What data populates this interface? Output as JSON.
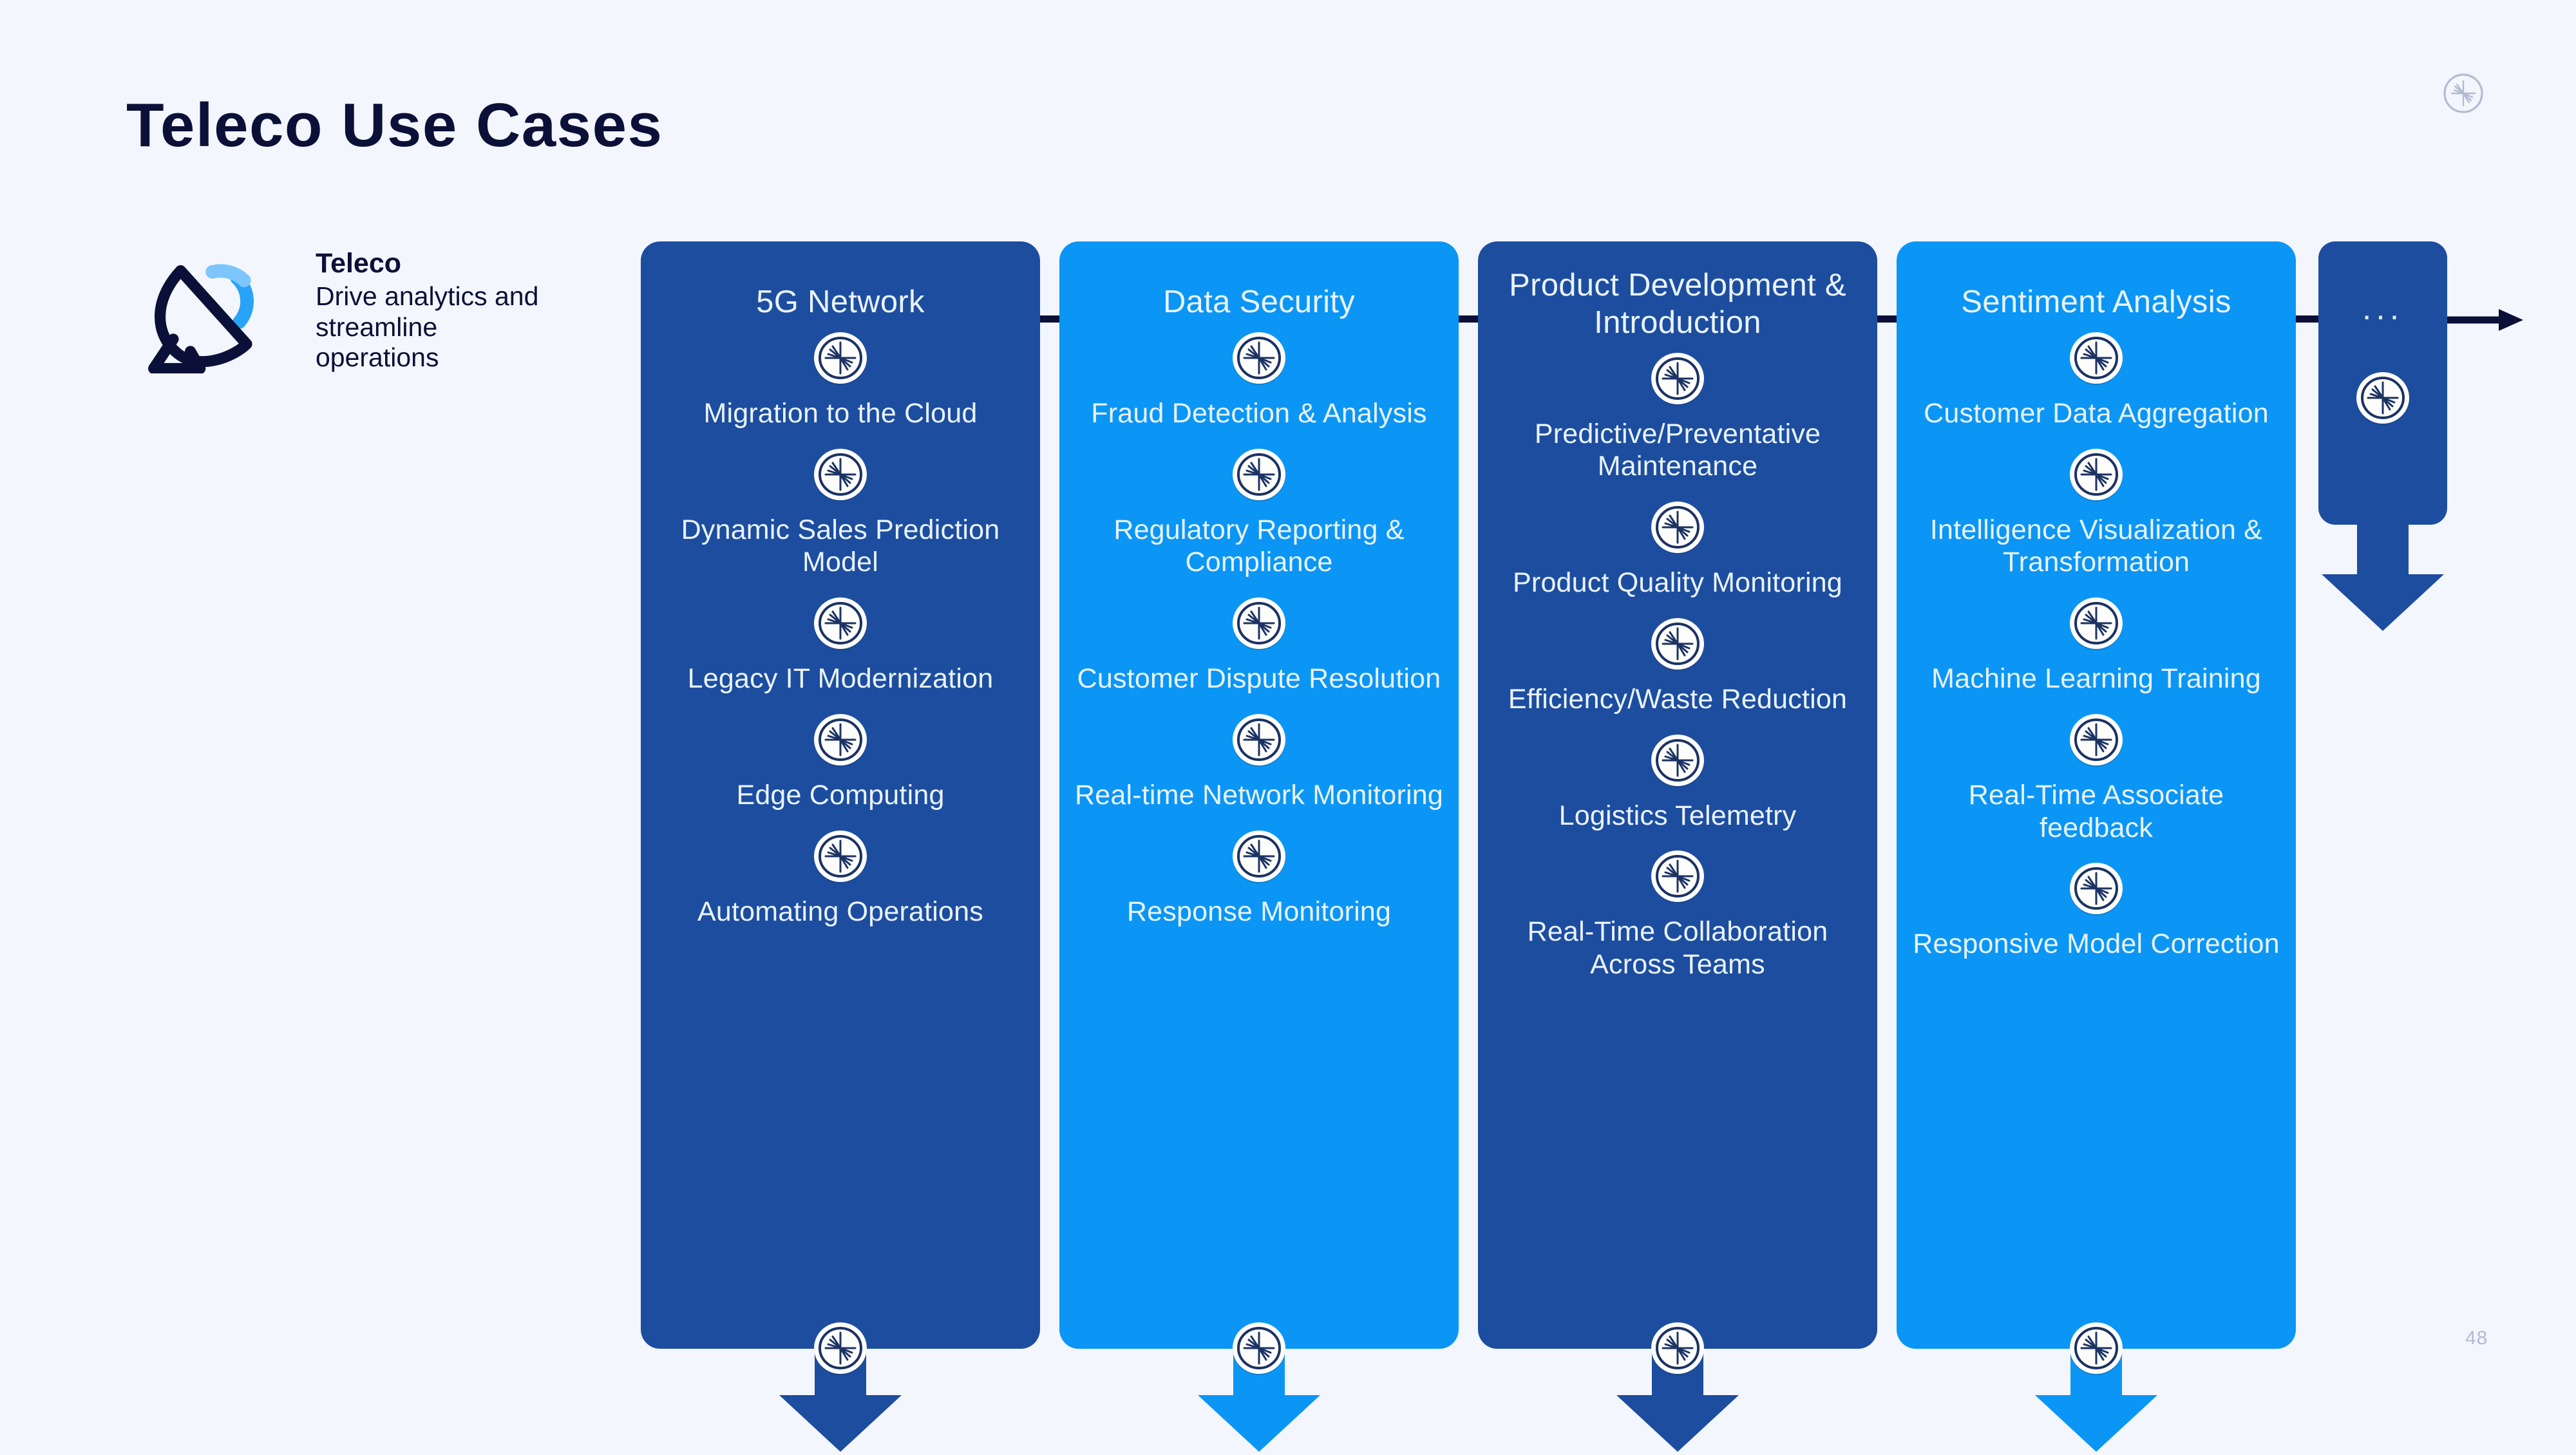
{
  "page": {
    "title": "Teleco Use Cases",
    "page_number": "48",
    "background_color": "#f3f6fd",
    "corner_logo_icon": "starburst-circle-icon"
  },
  "legend": {
    "icon": "satellite-dish-icon",
    "title": "Teleco",
    "description": "Drive analytics and streamline operations"
  },
  "flow": {
    "connector_color": "#0b1038",
    "arrow_icon": "arrow-right-icon",
    "more": {
      "dots": "...",
      "badge_icon": "starburst-badge-icon",
      "color": "#1d4d9f",
      "down_arrow_icon": "arrow-down-icon"
    }
  },
  "columns": [
    {
      "title": "5G Network",
      "color": "#1d4d9f",
      "theme": "dark",
      "badge_icon": "starburst-badge-icon",
      "down_arrow_icon": "arrow-down-icon",
      "items": [
        "Migration to the Cloud",
        "Dynamic Sales Prediction Model",
        "Legacy IT Modernization",
        "Edge Computing",
        "Automating Operations"
      ]
    },
    {
      "title": "Data Security",
      "color": "#0b96f5",
      "theme": "light",
      "badge_icon": "starburst-badge-icon",
      "down_arrow_icon": "arrow-down-icon",
      "items": [
        "Fraud Detection &  Analysis",
        "Regulatory Reporting & Compliance",
        "Customer Dispute Resolution",
        "Real-time Network Monitoring",
        "Response Monitoring"
      ]
    },
    {
      "title": "Product Development & Introduction",
      "color": "#1d4d9f",
      "theme": "dark",
      "badge_icon": "starburst-badge-icon",
      "down_arrow_icon": "arrow-down-icon",
      "items": [
        "Predictive/Preventative Maintenance",
        "Product Quality Monitoring",
        "Efficiency/Waste Reduction",
        "Logistics Telemetry",
        "Real-Time Collaboration Across Teams"
      ]
    },
    {
      "title": "Sentiment Analysis",
      "color": "#0b96f5",
      "theme": "light",
      "badge_icon": "starburst-badge-icon",
      "down_arrow_icon": "arrow-down-icon",
      "items": [
        "Customer Data Aggregation",
        "Intelligence Visualization & Transformation",
        "Machine Learning Training",
        "Real-Time Associate feedback",
        "Responsive Model Correction"
      ]
    }
  ]
}
